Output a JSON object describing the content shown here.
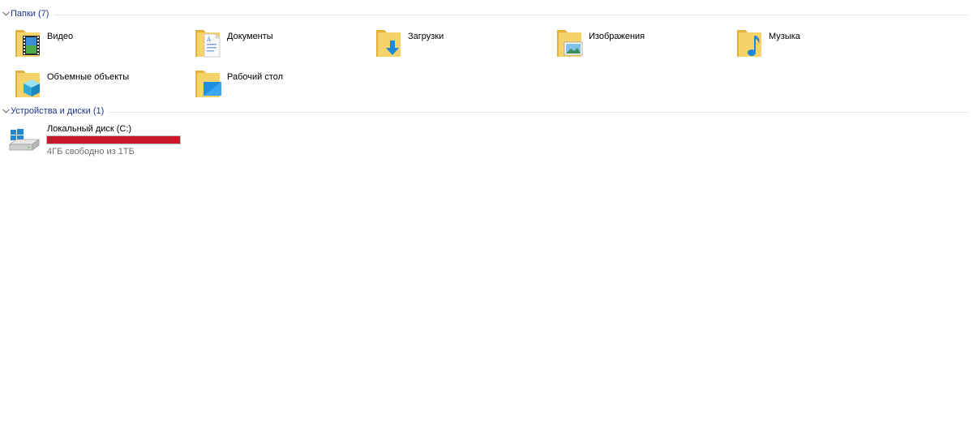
{
  "folders_group": {
    "title": "Папки (7)",
    "items": [
      {
        "label": "Видео",
        "icon": "video-folder-icon"
      },
      {
        "label": "Документы",
        "icon": "documents-folder-icon"
      },
      {
        "label": "Загрузки",
        "icon": "downloads-folder-icon"
      },
      {
        "label": "Изображения",
        "icon": "pictures-folder-icon"
      },
      {
        "label": "Музыка",
        "icon": "music-folder-icon"
      },
      {
        "label": "Объемные объекты",
        "icon": "3d-objects-folder-icon"
      },
      {
        "label": "Рабочий стол",
        "icon": "desktop-folder-icon"
      }
    ]
  },
  "devices_group": {
    "title": "Устройства и диски (1)",
    "drives": [
      {
        "label": "Локальный диск (C:)",
        "free_text": "4ГБ свободно из 1ТБ",
        "used_fraction": 1.0,
        "bar_color": "#c7192a",
        "icon": "windows-drive-icon"
      }
    ]
  },
  "colors": {
    "group_title": "#1e3287",
    "folder_yellow": "#f3c94f",
    "accent_blue": "#1e88d8"
  }
}
